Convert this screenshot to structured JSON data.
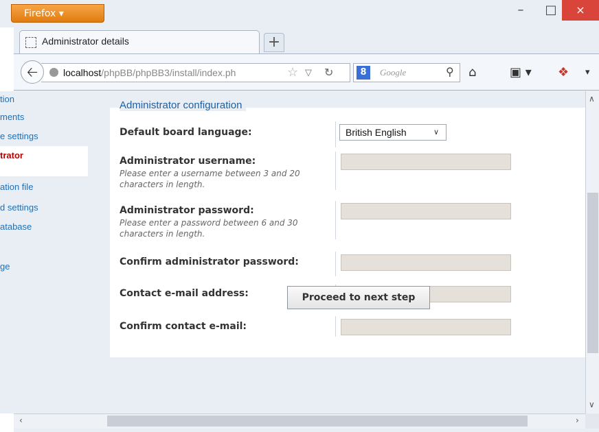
{
  "browser": {
    "menu_button": "Firefox",
    "window_controls": {
      "min": "–",
      "max": "□",
      "close": "×"
    },
    "tab": {
      "title": "Administrator details"
    },
    "new_tab_label": "+",
    "url": {
      "host": "localhost",
      "path": "/phpBB/phpBB3/install/index.ph"
    },
    "search_engine": "Google",
    "icons": [
      "back-icon",
      "globe-icon",
      "bookmark-star-icon",
      "reload-icon",
      "google-icon",
      "search-icon",
      "home-icon",
      "bookmarks-menu-icon",
      "addon-icon"
    ]
  },
  "sidebar": {
    "items": [
      {
        "label": "tion"
      },
      {
        "label": "ments"
      },
      {
        "label": "e settings"
      },
      {
        "label": "trator",
        "active": true
      },
      {
        "label": "ation file"
      },
      {
        "label": "d settings"
      },
      {
        "label": "atabase"
      },
      {
        "label": "ge"
      }
    ]
  },
  "form": {
    "legend": "Administrator configuration",
    "language_label": "Default board language:",
    "language_value": "British English",
    "username_label": "Administrator username:",
    "username_hint": "Please enter a username between 3 and 20 characters in length.",
    "password_label": "Administrator password:",
    "password_hint": "Please enter a password between 6 and 30 characters in length.",
    "confirm_password_label": "Confirm administrator password:",
    "email_label": "Contact e-mail address:",
    "confirm_email_label": "Confirm contact e-mail:",
    "username_value": "",
    "password_value": "",
    "confirm_password_value": "",
    "email_value": "",
    "confirm_email_value": ""
  },
  "actions": {
    "proceed_label": "Proceed to next step"
  },
  "colors": {
    "firefox_orange": "#e8891c",
    "close_red": "#d9453a",
    "link_blue": "#1d6fb8",
    "active_red": "#b10000",
    "field_bg": "#e5e0da"
  }
}
